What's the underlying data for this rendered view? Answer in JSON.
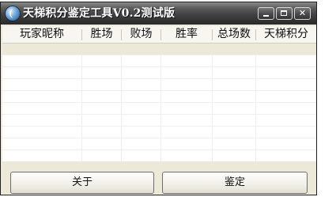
{
  "window": {
    "title": "天梯积分鉴定工具V0.2测试版"
  },
  "title_controls": [
    "minimize",
    "maximize",
    "close"
  ],
  "table": {
    "columns": [
      "玩家昵称",
      "胜场",
      "败场",
      "胜率",
      "总场数",
      "天梯积分"
    ],
    "rows": []
  },
  "buttons": {
    "about": "关于",
    "evaluate": "鉴定"
  },
  "icons": {
    "app": "app-globe-icon",
    "close": "close-icon"
  },
  "colors": {
    "titlebar": "#3e3e3e",
    "window_bg": "#ece9d8",
    "list_bg": "#ffffff"
  }
}
